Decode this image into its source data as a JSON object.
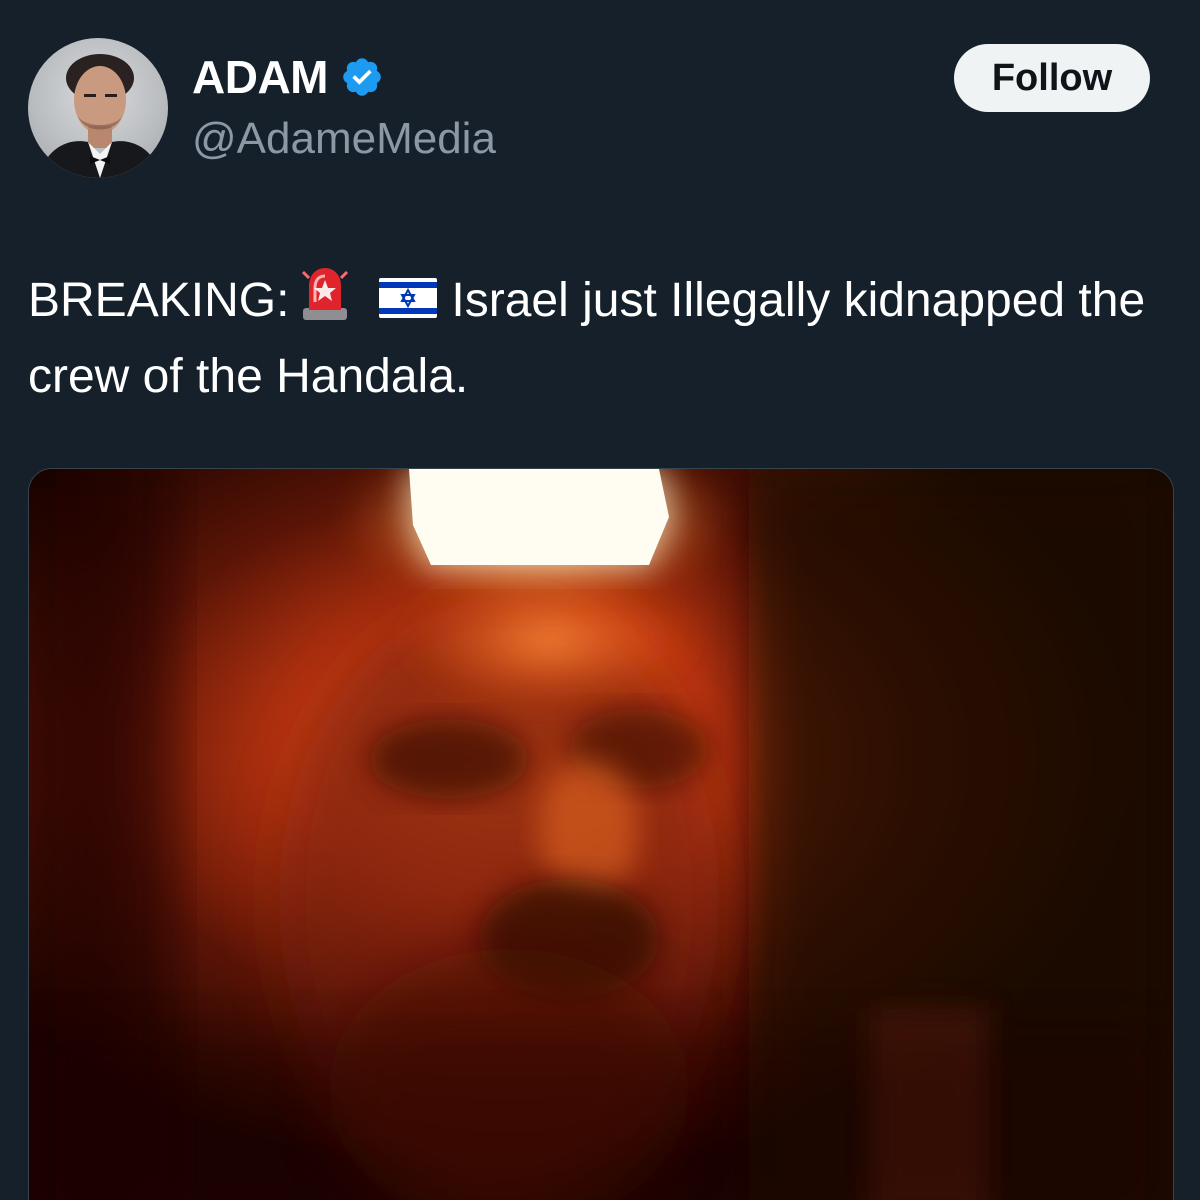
{
  "author": {
    "display_name": "ADAM",
    "handle": "@AdameMedia",
    "verified": true
  },
  "follow_button": {
    "label": "Follow"
  },
  "tweet": {
    "text_prefix": "BREAKING:",
    "emojis": [
      "police-car-light",
      "flag-israel"
    ],
    "text_main": "Israel just Illegally kidnapped the crew of the Handala."
  },
  "colors": {
    "background": "#15202b",
    "handle_gray": "#8b98a5",
    "verified_blue": "#1d9bf0",
    "follow_button_bg": "#eff3f4"
  }
}
